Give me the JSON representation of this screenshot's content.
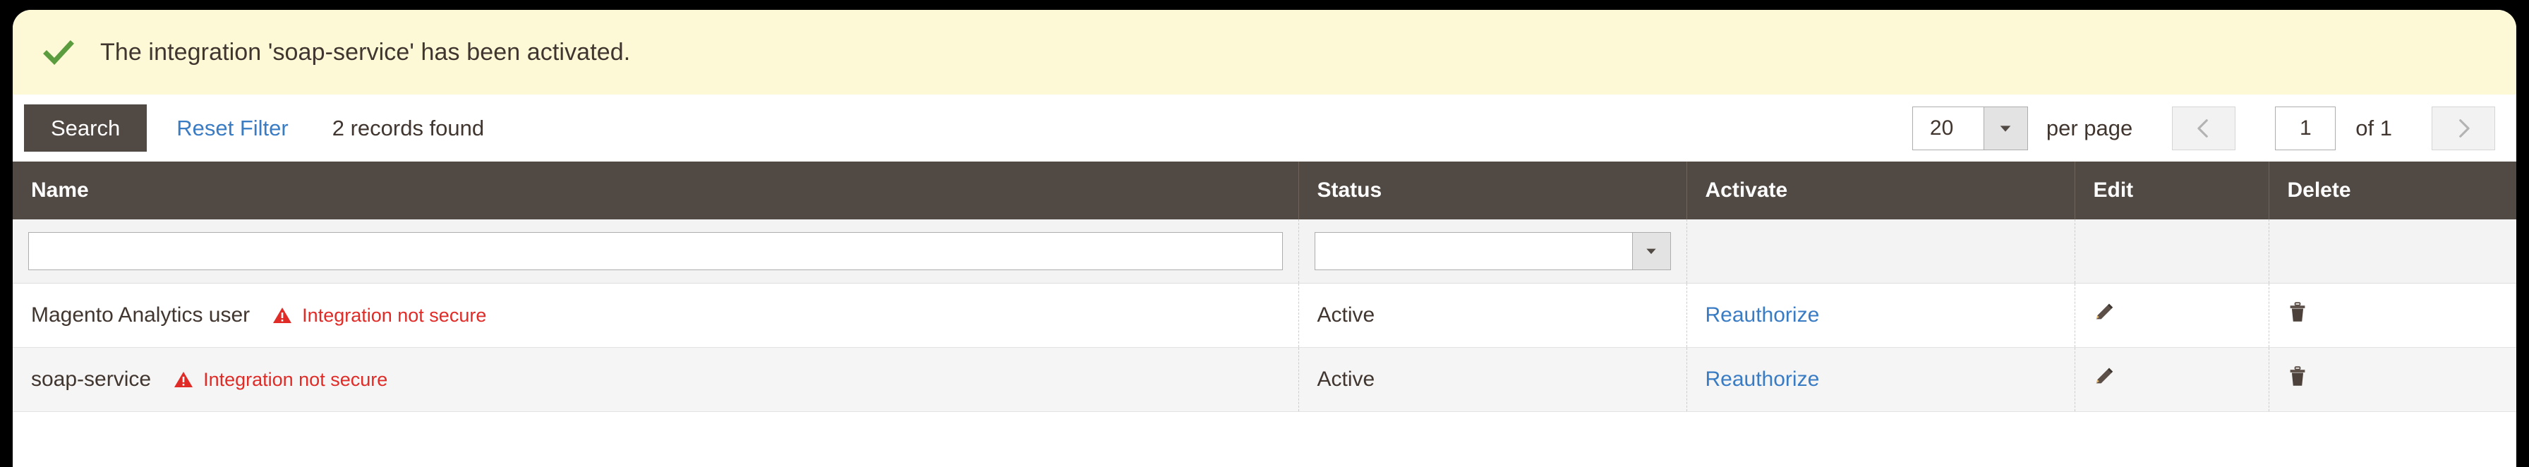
{
  "notice": {
    "icon": "check-icon",
    "message": "The integration 'soap-service' has been activated."
  },
  "toolbar": {
    "search_label": "Search",
    "reset_filter_label": "Reset Filter",
    "records_found": "2 records found"
  },
  "pager": {
    "limit_value": "20",
    "limit_arrow_icon": "chevron-down-icon",
    "per_page_label": "per page",
    "previous_icon": "chevron-left-icon",
    "current_page": "1",
    "of_label": "of 1",
    "next_icon": "chevron-right-icon"
  },
  "grid": {
    "columns": [
      {
        "key": "name",
        "label": "Name"
      },
      {
        "key": "status",
        "label": "Status"
      },
      {
        "key": "activate",
        "label": "Activate"
      },
      {
        "key": "edit",
        "label": "Edit"
      },
      {
        "key": "delete",
        "label": "Delete"
      }
    ],
    "filters": {
      "name_value": "",
      "status_value": "",
      "status_arrow_icon": "chevron-down-icon"
    },
    "rows": [
      {
        "name": "Magento Analytics user",
        "secure_warning": "Integration not secure",
        "warning_icon": "warning-triangle-icon",
        "status": "Active",
        "activate_link": "Reauthorize",
        "edit_icon": "pencil-icon",
        "delete_icon": "trash-icon"
      },
      {
        "name": "soap-service",
        "secure_warning": "Integration not secure",
        "warning_icon": "warning-triangle-icon",
        "status": "Active",
        "activate_link": "Reauthorize",
        "edit_icon": "pencil-icon",
        "delete_icon": "trash-icon"
      }
    ]
  },
  "colors": {
    "notice_bg": "#fdf8d6",
    "check_green": "#5a9c3e",
    "header_brown": "#514943",
    "link_blue": "#3a7cc4",
    "warning_red": "#e02b27",
    "row_alt_bg": "#f5f5f5"
  }
}
